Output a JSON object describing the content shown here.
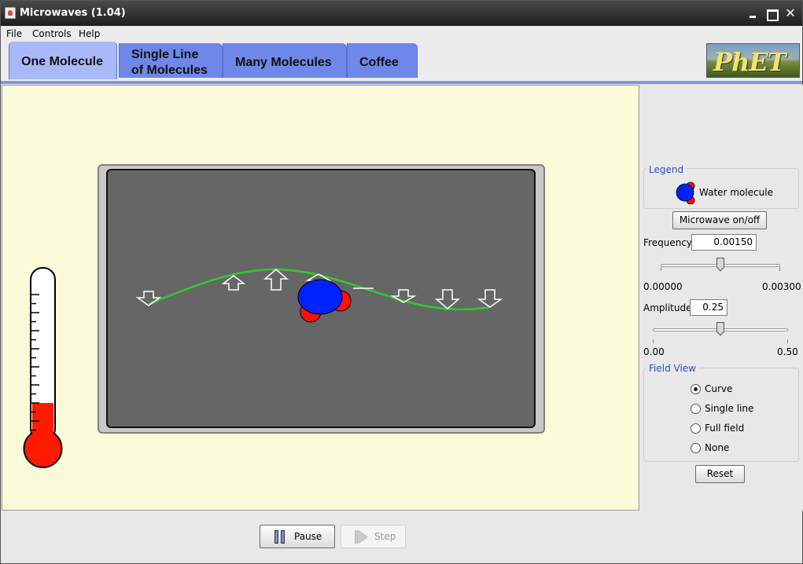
{
  "window": {
    "title": "Microwaves (1.04)",
    "controls": [
      "minimize",
      "maximize",
      "close"
    ]
  },
  "menu": {
    "items": [
      "File",
      "Controls",
      "Help"
    ]
  },
  "tabs": [
    {
      "label_line1": "One Molecule",
      "label_line2": "",
      "active": true
    },
    {
      "label_line1": "Single Line",
      "label_line2": "of Molecules",
      "active": false
    },
    {
      "label_line1": "Many Molecules",
      "label_line2": "",
      "active": false
    },
    {
      "label_line1": "Coffee",
      "label_line2": "",
      "active": false
    }
  ],
  "logo": {
    "text": "PhET"
  },
  "legend": {
    "title": "Legend",
    "water_molecule_label": "Water molecule"
  },
  "controls": {
    "microwave_toggle_label": "Microwave on/off",
    "frequency": {
      "label": "Frequency",
      "value": "0.00150",
      "min_label": "0.00000",
      "max_label": "0.00300",
      "fraction": 0.5
    },
    "amplitude": {
      "label": "Amplitude",
      "value": "0.25",
      "min_label": "0.00",
      "max_label": "0.50",
      "fraction": 0.5
    }
  },
  "field_view": {
    "title": "Field View",
    "options": [
      {
        "label": "Curve",
        "checked": true
      },
      {
        "label": "Single line",
        "checked": false
      },
      {
        "label": "Full field",
        "checked": false
      },
      {
        "label": "None",
        "checked": false
      }
    ]
  },
  "reset_label": "Reset",
  "playback": {
    "pause_label": "Pause",
    "step_label": "Step"
  },
  "thermometer": {
    "level_fraction": 0.22
  },
  "colors": {
    "tab_active": "#a9b9f7",
    "tab_inactive": "#6f87e8",
    "play_background": "#fbfbd9",
    "oven_interior": "#666666",
    "field_curve": "#2ecc2e",
    "oxygen": "#0022ff",
    "hydrogen": "#ff1100",
    "thermometer_fluid": "#ff1a00"
  }
}
